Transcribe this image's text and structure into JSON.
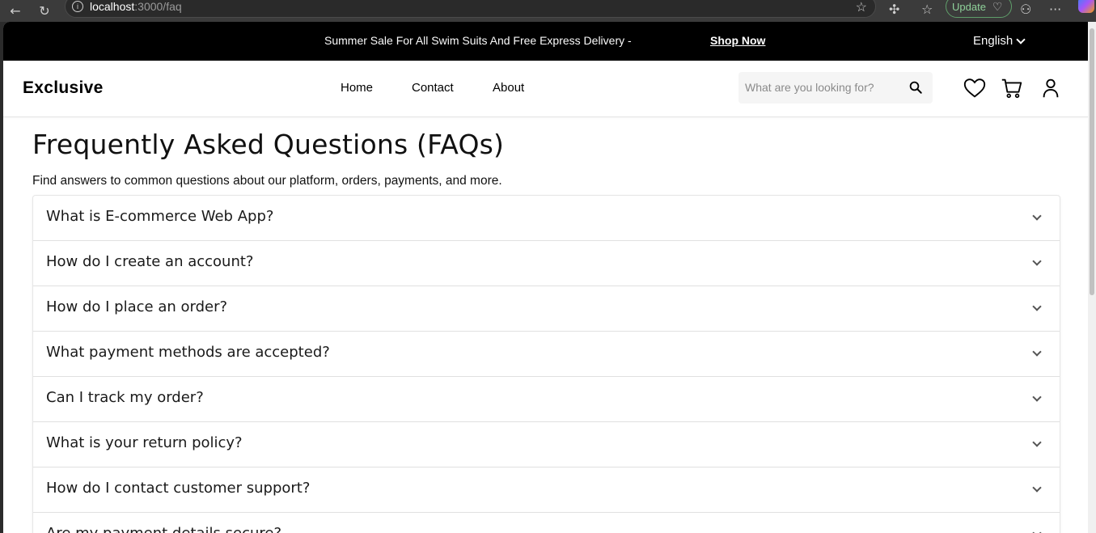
{
  "browser": {
    "url_host": "localhost",
    "url_path": ":3000/faq",
    "update_label": "Update"
  },
  "promo": {
    "message": "Summer Sale For All Swim Suits And Free Express Delivery -",
    "shop_label": "Shop Now",
    "language": "English"
  },
  "header": {
    "logo": "Exclusive",
    "nav": [
      "Home",
      "Contact",
      "About"
    ],
    "search_placeholder": "What are you looking for?"
  },
  "faq": {
    "title": "Frequently Asked Questions (FAQs)",
    "subtitle": "Find answers to common questions about our platform, orders, payments, and more.",
    "items": [
      "What is E-commerce Web App?",
      "How do I create an account?",
      "How do I place an order?",
      "What payment methods are accepted?",
      "Can I track my order?",
      "What is your return policy?",
      "How do I contact customer support?",
      "Are my payment details secure?"
    ]
  }
}
